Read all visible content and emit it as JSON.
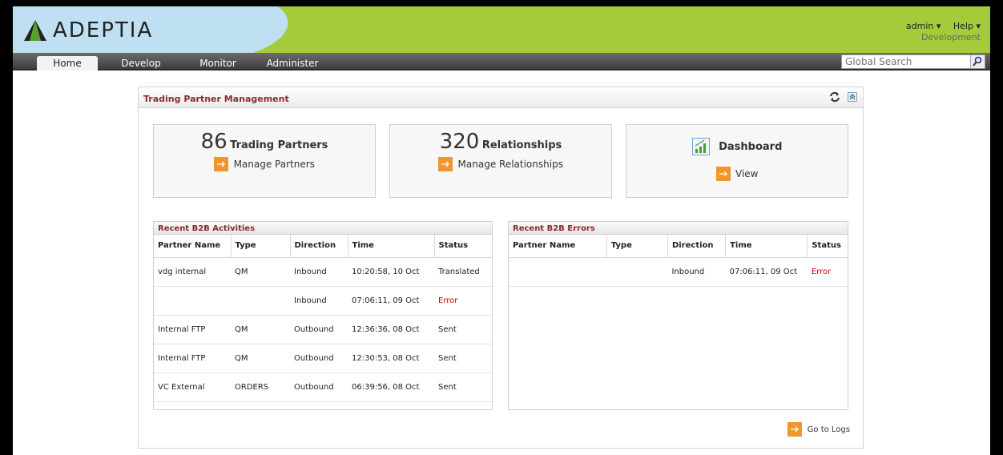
{
  "header": {
    "logo_text": "ADEPTIA",
    "user_menu": "admin ▾",
    "help_menu": "Help ▾",
    "environment": "Development"
  },
  "nav": {
    "tabs": [
      {
        "label": "Home"
      },
      {
        "label": "Develop"
      },
      {
        "label": "Monitor"
      },
      {
        "label": "Administer"
      }
    ],
    "search_placeholder": "Global Search"
  },
  "panel": {
    "title": "Trading Partner Management",
    "cards": {
      "partners": {
        "count": "86",
        "label": "Trading Partners",
        "link": "Manage Partners"
      },
      "relationships": {
        "count": "320",
        "label": "Relationships",
        "link": "Manage Relationships"
      },
      "dashboard": {
        "label": "Dashboard",
        "link": "View"
      }
    },
    "activities": {
      "title": "Recent B2B Activities",
      "columns": [
        "Partner Name",
        "Type",
        "Direction",
        "Time",
        "Status"
      ],
      "rows": [
        {
          "partner": "vdg internal",
          "type": "QM",
          "direction": "Inbound",
          "time": "10:20:58, 10 Oct",
          "status": "Translated"
        },
        {
          "partner": "",
          "type": "",
          "direction": "Inbound",
          "time": "07:06:11, 09 Oct",
          "status": "Error"
        },
        {
          "partner": "Internal FTP",
          "type": "QM",
          "direction": "Outbound",
          "time": "12:36:36, 08 Oct",
          "status": "Sent"
        },
        {
          "partner": "Internal FTP",
          "type": "QM",
          "direction": "Outbound",
          "time": "12:30:53, 08 Oct",
          "status": "Sent"
        },
        {
          "partner": "VC External",
          "type": "ORDERS",
          "direction": "Outbound",
          "time": "06:39:56, 08 Oct",
          "status": "Sent"
        }
      ]
    },
    "errors": {
      "title": "Recent B2B Errors",
      "columns": [
        "Partner Name",
        "Type",
        "Direction",
        "Time",
        "Status"
      ],
      "rows": [
        {
          "partner": "",
          "type": "",
          "direction": "Inbound",
          "time": "07:06:11, 09 Oct",
          "status": "Error"
        }
      ]
    },
    "go_to_logs": "Go to Logs"
  },
  "colors": {
    "header_green": "#a6cb3a",
    "header_blue": "#bfe0f2",
    "accent_orange": "#f0962a",
    "title_red": "#8a2b2b",
    "error_red": "#d40000"
  }
}
